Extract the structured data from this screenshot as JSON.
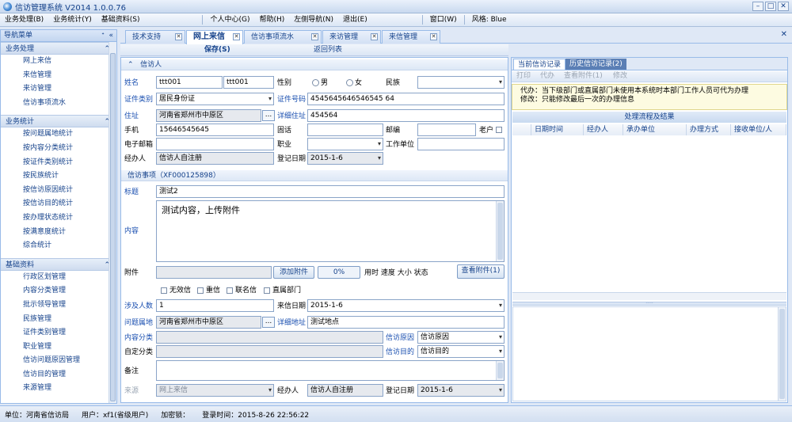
{
  "window": {
    "title": "信访管理系统 V2014 1.0.0.76"
  },
  "menu": {
    "items": [
      "业务处理(B)",
      "业务统计(Y)",
      "基础资料(S)",
      "个人中心(G)",
      "帮助(H)",
      "左侧导航(N)",
      "退出(E)",
      "窗口(W)",
      "风格: Blue"
    ]
  },
  "sidebar": {
    "title": "导航菜单",
    "groups": [
      {
        "title": "业务处理",
        "items": [
          "网上来信",
          "来信管理",
          "来访管理",
          "信访事项流水"
        ]
      },
      {
        "title": "业务统计",
        "items": [
          "按问题属地统计",
          "按内容分类统计",
          "按证件类别统计",
          "按民族统计",
          "按信访原因统计",
          "按信访目的统计",
          "按办理状态统计",
          "按满意度统计",
          "综合统计"
        ]
      },
      {
        "title": "基础资料",
        "items": [
          "行政区划管理",
          "内容分类管理",
          "批示领导管理",
          "民族管理",
          "证件类别管理",
          "职业管理",
          "信访问题原因管理",
          "信访目的管理",
          "来源管理"
        ]
      }
    ]
  },
  "tabs": [
    {
      "label": "技术支持"
    },
    {
      "label": "网上来信"
    },
    {
      "label": "信访事项流水"
    },
    {
      "label": "来访管理"
    },
    {
      "label": "来信管理"
    }
  ],
  "toolbar": {
    "save": "保存(S)",
    "back": "返回列表"
  },
  "form": {
    "petitioner_section": "信访人",
    "name_label": "姓名",
    "name1": "ttt001",
    "name2": "ttt001",
    "gender_label": "性别",
    "male": "男",
    "female": "女",
    "ethnic_label": "民族",
    "ethnic_value": "",
    "idtype_label": "证件类别",
    "idtype_value": "居民身份证",
    "idno_label": "证件号码",
    "idno_value": "4545645646546545 64",
    "addr_label": "住址",
    "addr_value": "河南省郑州市中原区",
    "addr_detail_label": "详细住址",
    "addr_detail_value": "454564",
    "mobile_label": "手机",
    "mobile_value": "15646545645",
    "phone_label": "固话",
    "phone_value": "",
    "zip_label": "邮编",
    "zip_value": "",
    "elder_label": "老户",
    "email_label": "电子邮箱",
    "email_value": "",
    "job_label": "职业",
    "job_value": "",
    "workunit_label": "工作单位",
    "workunit_value": "",
    "handler_label": "经办人",
    "handler_value": "信访人自注册",
    "regdate_label": "登记日期",
    "regdate_value": "2015-1-6",
    "matter_section": "信访事项（XF000125898）",
    "title_label": "标题",
    "title_value": "测试2",
    "content_label": "内容",
    "content_value": "测试内容，上传附件",
    "attach_label": "附件",
    "attach_value": "",
    "add_attach": "添加附件",
    "progress": "0%",
    "attach_info": "用时  速度  大小  状态",
    "view_attach": "查看附件(1)",
    "invalid": "无效信",
    "repeat": "重信",
    "joint": "联名信",
    "direct": "直属部门",
    "people_label": "涉及人数",
    "people_value": "1",
    "letterdate_label": "来信日期",
    "letterdate_value": "2015-1-6",
    "probplace_label": "问题属地",
    "probplace_value": "河南省郑州市中原区",
    "detailaddr_label": "详细地址",
    "detailaddr_value": "测试地点",
    "category_label": "内容分类",
    "category_value": "",
    "reason_label": "信访原因",
    "reason_value": "信访原因",
    "custom_label": "自定分类",
    "custom_value": "",
    "purpose_label": "信访目的",
    "purpose_value": "信访目的",
    "remark_label": "备注",
    "source_label": "来源",
    "source_value": "网上来信",
    "handler2_label": "经办人",
    "handler2_value": "信访人自注册",
    "regdate2_label": "登记日期",
    "regdate2_value": "2015-1-6"
  },
  "right": {
    "tab_current": "当前信访记录",
    "tab_history": "历史信访记录(2)",
    "tools": [
      "打印",
      "代办",
      "查看附件(1)",
      "修改"
    ],
    "notice1": "代办：当下级部门或直属部门未使用本系统时本部门工作人员可代为办理",
    "notice2": "修改：只能修改最后一次的办理信息",
    "flow_title": "处理流程及结果",
    "columns": [
      "日期时间",
      "经办人",
      "承办单位",
      "办理方式",
      "接收单位/人"
    ]
  },
  "status": {
    "unit": "单位：河南省信访局",
    "user": "用户：xf1(省级用户)",
    "lock": "加密锁：",
    "login": "登录时间：2015-8-26 22:56:22"
  }
}
